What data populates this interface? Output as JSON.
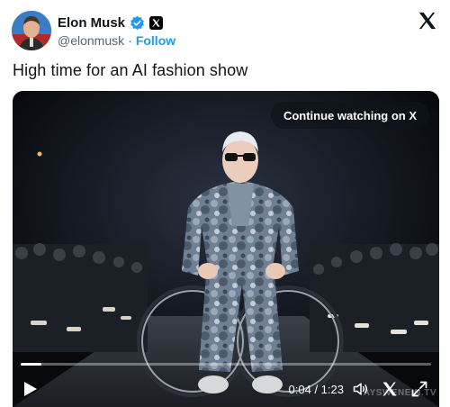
{
  "author": {
    "display_name": "Elon Musk",
    "handle": "@elonmusk",
    "separator": "·",
    "follow_label": "Follow",
    "affiliate_badge": "x-badge-icon"
  },
  "tweet": {
    "text": "High time for an AI fashion show"
  },
  "video": {
    "continue_label": "Continue watching on X",
    "time_display": "0:04 / 1:23",
    "progress_fraction": 0.05,
    "watermark": "AYSWENEIN.TV"
  },
  "colors": {
    "follow_link": "#1d9bf0",
    "verified_badge": "#1d9bf0",
    "secondary_text": "#536471"
  }
}
